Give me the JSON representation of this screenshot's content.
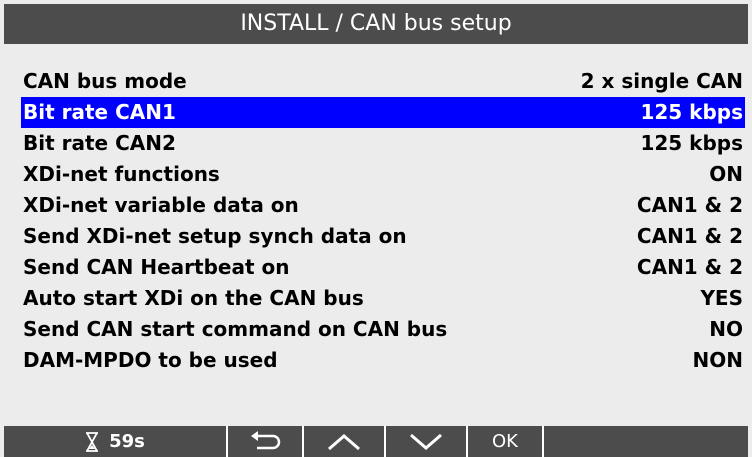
{
  "header": {
    "title": "INSTALL / CAN bus setup"
  },
  "menu": {
    "items": [
      {
        "label": "CAN bus mode",
        "value": "2 x single CAN",
        "selected": false
      },
      {
        "label": "Bit rate CAN1",
        "value": "125 kbps",
        "selected": true
      },
      {
        "label": "Bit rate CAN2",
        "value": "125 kbps",
        "selected": false
      },
      {
        "label": "XDi-net functions",
        "value": "ON",
        "selected": false
      },
      {
        "label": "XDi-net variable data on",
        "value": "CAN1 & 2",
        "selected": false
      },
      {
        "label": "Send XDi-net setup synch data on",
        "value": "CAN1 & 2",
        "selected": false
      },
      {
        "label": "Send CAN Heartbeat on",
        "value": "CAN1 & 2",
        "selected": false
      },
      {
        "label": "Auto start XDi on the CAN bus",
        "value": "YES",
        "selected": false
      },
      {
        "label": "Send CAN start command on CAN bus",
        "value": "NO",
        "selected": false
      },
      {
        "label": "DAM-MPDO to be used",
        "value": "NON",
        "selected": false
      }
    ]
  },
  "footer": {
    "timer_icon": "hourglass-icon",
    "timer_text": "59s",
    "back_icon": "back-arrow-icon",
    "up_icon": "chevron-up-icon",
    "down_icon": "chevron-down-icon",
    "ok_label": "OK"
  },
  "colors": {
    "bar_background": "#4c4c4c",
    "selection": "#0000ff",
    "screen_background": "#ececec"
  }
}
